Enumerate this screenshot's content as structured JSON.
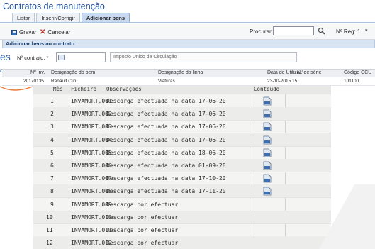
{
  "window": {
    "title": "Contratos de manutenção"
  },
  "tabs": [
    {
      "label": "Listar",
      "active": false
    },
    {
      "label": "Inserir/Corrigir",
      "active": false
    },
    {
      "label": "Adicionar bens",
      "active": true
    }
  ],
  "toolbar": {
    "save_label": "Gravar",
    "cancel_label": "Cancelar",
    "search_label": "Procurar:",
    "search_value": "",
    "reg_label": "Nº Reg: 1",
    "reg_dropdown": "▾"
  },
  "section": {
    "title": "Adicionar bens ao contrato"
  },
  "contract": {
    "label": "Nº contrato: *",
    "description": "Imposto Unico de Circulação"
  },
  "grid": {
    "headers": [
      "Nº Inv.",
      "Designação do bem",
      "Designação da linha",
      "Data de Utiliza...",
      "Nº de série",
      "Código CCU"
    ],
    "rows": [
      [
        "20170135",
        "Renault Clio",
        "Viaturas",
        "23-10-2015 15...",
        "",
        "101100"
      ]
    ]
  },
  "side": {
    "text": "es",
    "small": "Des"
  },
  "overlay": {
    "headers": [
      "Mês",
      "Ficheiro",
      "Observações",
      "Conteúdo"
    ],
    "rows": [
      {
        "month": "1",
        "file": "INVAMORT.001",
        "obs": "Descarga efectuada na data 17-06-20",
        "has_content": true
      },
      {
        "month": "2",
        "file": "INVAMORT.002",
        "obs": "Descarga efectuada na data 17-06-20",
        "has_content": true
      },
      {
        "month": "3",
        "file": "INVAMORT.003",
        "obs": "Descarga efectuada na data 17-06-20",
        "has_content": true
      },
      {
        "month": "4",
        "file": "INVAMORT.004",
        "obs": "Descarga efectuada na data 17-06-20",
        "has_content": true
      },
      {
        "month": "5",
        "file": "INVAMORT.005",
        "obs": "Descarga efectuada na data 18-06-20",
        "has_content": true
      },
      {
        "month": "6",
        "file": "INVAMORT.006",
        "obs": "Descarga efectuada na data 01-09-20",
        "has_content": true
      },
      {
        "month": "7",
        "file": "INVAMORT.007",
        "obs": "Descarga efectuada na data 17-10-20",
        "has_content": true
      },
      {
        "month": "8",
        "file": "INVAMORT.008",
        "obs": "Descarga efectuada na data 17-11-20",
        "has_content": true
      },
      {
        "month": "9",
        "file": "INVAMORT.009",
        "obs": "Descarga por efectuar",
        "has_content": false
      },
      {
        "month": "10",
        "file": "INVAMORT.010",
        "obs": "Descarga por efectuar",
        "has_content": false
      },
      {
        "month": "11",
        "file": "INVAMORT.011",
        "obs": "Descarga por efectuar",
        "has_content": false
      },
      {
        "month": "12",
        "file": "INVAMORT.012",
        "obs": "Descarga por efectuar",
        "has_content": false
      }
    ]
  },
  "colors": {
    "accent": "#1f4e9a",
    "tab_active": "#c9daf0",
    "section": "#d8e4f2"
  }
}
